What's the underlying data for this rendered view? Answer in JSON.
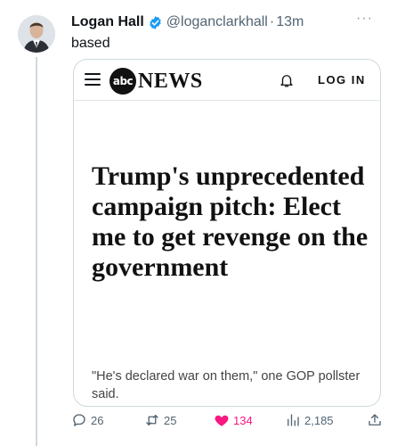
{
  "tweet": {
    "author_name": "Logan Hall",
    "handle": "@loganclarkhall",
    "separator": "·",
    "time": "13m",
    "more": "···",
    "text": "based"
  },
  "card": {
    "logo_abc": "abc",
    "logo_news": "NEWS",
    "login_label": "LOG IN",
    "headline": "Trump's unprecedented campaign pitch: Elect me to get revenge on the government",
    "subhead": "\"He's declared war on them,\" one GOP pollster said."
  },
  "actions": {
    "replies": "26",
    "retweets": "25",
    "likes": "134",
    "views": "2,185"
  },
  "colors": {
    "verified": "#1d9bf0",
    "like": "#f91880",
    "muted": "#536471"
  }
}
